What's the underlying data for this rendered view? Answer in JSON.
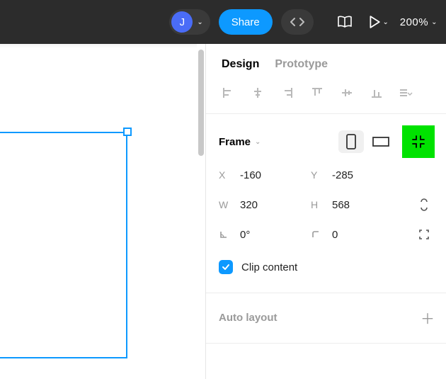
{
  "topbar": {
    "user_initial": "J",
    "share_label": "Share",
    "zoom_label": "200%"
  },
  "panel": {
    "tabs": {
      "design": "Design",
      "prototype": "Prototype"
    },
    "frame": {
      "label": "Frame",
      "x_label": "X",
      "x_value": "-160",
      "y_label": "Y",
      "y_value": "-285",
      "w_label": "W",
      "w_value": "320",
      "h_label": "H",
      "h_value": "568",
      "rotation_value": "0°",
      "radius_value": "0",
      "clip_label": "Clip content"
    },
    "auto_layout_label": "Auto layout"
  }
}
